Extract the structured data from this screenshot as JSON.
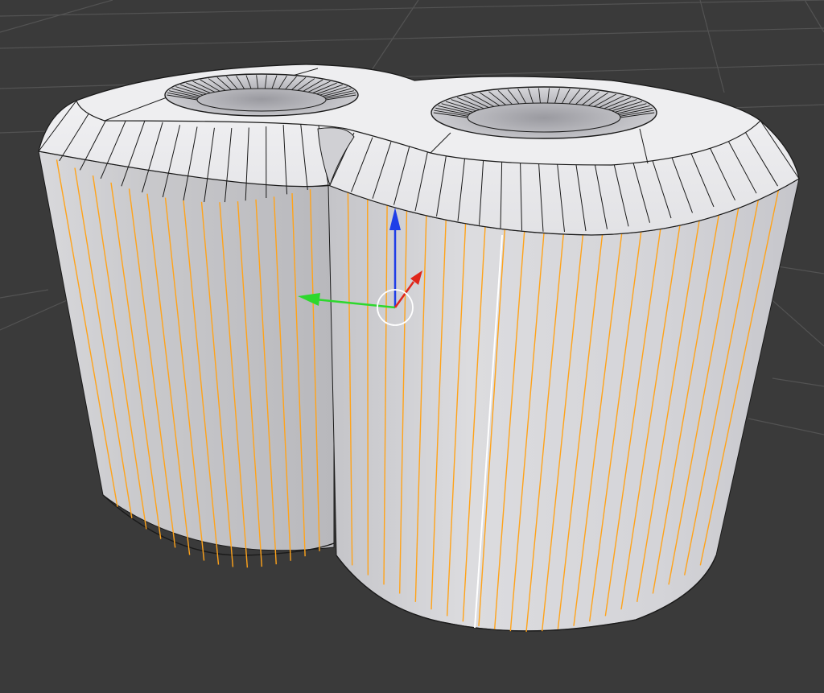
{
  "viewport": {
    "background": "#3a3a3a",
    "grid_color": "#535353"
  },
  "mesh": {
    "object": "double-hole-spacer",
    "fill_light": "#ebebed",
    "fill_shadow": "#b9b9bd",
    "wire_color": "#1a1a1a",
    "selected_edge_color": "#ffa31a",
    "active_edge_color": "#ffffff",
    "selection": "side edges",
    "holes": 2
  },
  "gizmo": {
    "x_color": "#e0261b",
    "y_color": "#2dd82d",
    "z_color": "#1f3ee8",
    "ring_color": "#ffffff"
  }
}
